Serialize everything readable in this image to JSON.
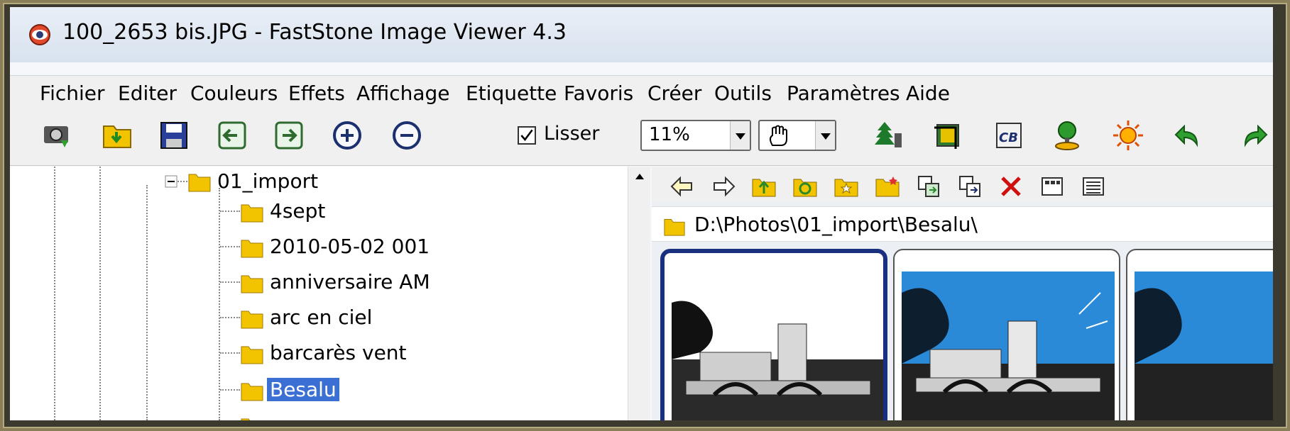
{
  "window": {
    "title": "100_2653 bis.JPG  -  FastStone Image Viewer 4.3"
  },
  "menu": [
    "Fichier",
    "Editer",
    "Couleurs",
    "Effets",
    "Affichage",
    "Etiquette",
    "Favoris",
    "Créer",
    "Outils",
    "Paramètres",
    "Aide"
  ],
  "toolbar": {
    "smooth_label": "Lisser",
    "smooth_checked": true,
    "zoom_value": "11%",
    "icons": [
      "acquire-icon",
      "open-folder-icon",
      "save-icon",
      "previous-icon",
      "next-icon",
      "zoom-in-icon",
      "zoom-out-icon",
      "hand-tool-icon",
      "tree-icon",
      "crop-icon",
      "cb-icon",
      "wallpaper-icon",
      "brightness-icon",
      "undo-icon"
    ]
  },
  "tree": {
    "root": "01_import",
    "children": [
      "4sept",
      "2010-05-02 001",
      "anniversaire AM",
      "arc en ciel",
      "barcarès vent",
      "Besalu"
    ],
    "selected": "Besalu"
  },
  "browser": {
    "path": "D:\\Photos\\01_import\\Besalu\\",
    "thumbnails": [
      {
        "selected": true
      },
      {
        "selected": false
      },
      {
        "selected": false
      }
    ]
  },
  "colors": {
    "selection": "#3b6fd4",
    "thumb_border_selected": "#18307f",
    "background": "#8a7f58"
  }
}
